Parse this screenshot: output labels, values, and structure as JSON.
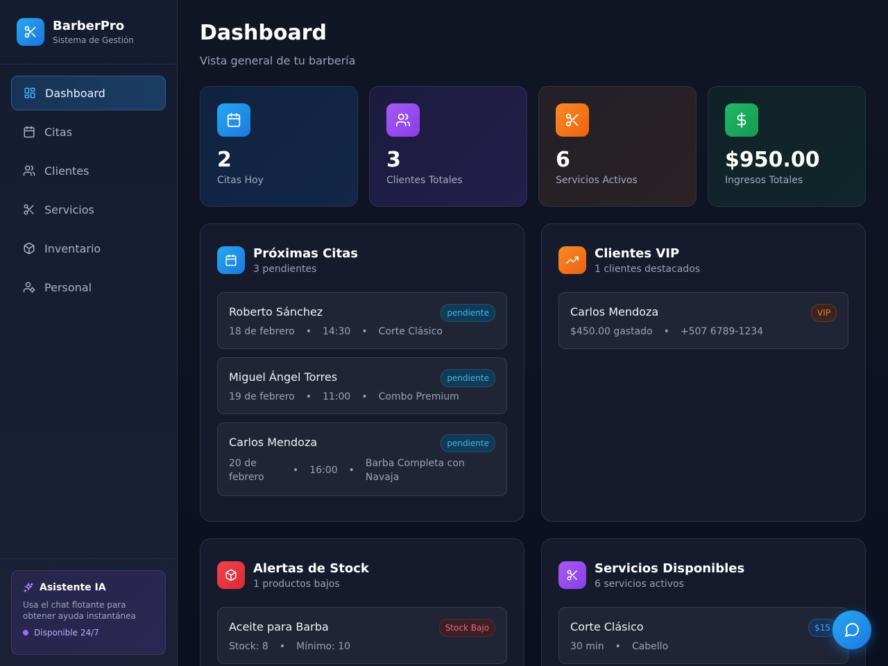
{
  "brand": {
    "name": "BarberPro",
    "subtitle": "Sistema de Gestión"
  },
  "nav": [
    {
      "label": "Dashboard",
      "icon": "dashboard-icon",
      "active": true
    },
    {
      "label": "Citas",
      "icon": "calendar-icon"
    },
    {
      "label": "Clientes",
      "icon": "users-icon"
    },
    {
      "label": "Servicios",
      "icon": "scissors-icon"
    },
    {
      "label": "Inventario",
      "icon": "package-icon"
    },
    {
      "label": "Personal",
      "icon": "user-cog-icon"
    }
  ],
  "assistant": {
    "title": "Asistente IA",
    "description": "Usa el chat flotante para obtener ayuda instantánea",
    "status": "Disponible 24/7"
  },
  "header": {
    "title": "Dashboard",
    "subtitle": "Vista general de tu barbería"
  },
  "stats": [
    {
      "value": "2",
      "label": "Citas Hoy",
      "icon": "calendar-icon",
      "color": "#1e9be8"
    },
    {
      "value": "3",
      "label": "Clientes Totales",
      "icon": "users-icon",
      "color": "#9b4ef0"
    },
    {
      "value": "6",
      "label": "Servicios Activos",
      "icon": "scissors-icon",
      "color": "#f2731c"
    },
    {
      "value": "$950.00",
      "label": "Ingresos Totales",
      "icon": "dollar-icon",
      "color": "#19a85a"
    }
  ],
  "appointments": {
    "title": "Próximas Citas",
    "subtitle": "3 pendientes",
    "items": [
      {
        "name": "Roberto Sánchez",
        "date": "18 de febrero",
        "time": "14:30",
        "service": "Corte Clásico",
        "status": "pendiente"
      },
      {
        "name": "Miguel Ángel Torres",
        "date": "19 de febrero",
        "time": "11:00",
        "service": "Combo Premium",
        "status": "pendiente"
      },
      {
        "name": "Carlos Mendoza",
        "date": "20 de febrero",
        "time": "16:00",
        "service": "Barba Completa con Navaja",
        "status": "pendiente"
      }
    ]
  },
  "vip": {
    "title": "Clientes VIP",
    "subtitle": "1 clientes destacados",
    "items": [
      {
        "name": "Carlos Mendoza",
        "spent": "$450.00 gastado",
        "phone": "+507 6789-1234",
        "badge": "VIP"
      }
    ]
  },
  "stock": {
    "title": "Alertas de Stock",
    "subtitle": "1 productos bajos",
    "items": [
      {
        "name": "Aceite para Barba",
        "stock": "Stock: 8",
        "minimum": "Mínimo: 10",
        "badge": "Stock Bajo"
      }
    ]
  },
  "services": {
    "title": "Servicios Disponibles",
    "subtitle": "6 servicios activos",
    "items": [
      {
        "name": "Corte Clásico",
        "duration": "30 min",
        "category": "Cabello",
        "price": "$15"
      }
    ]
  }
}
